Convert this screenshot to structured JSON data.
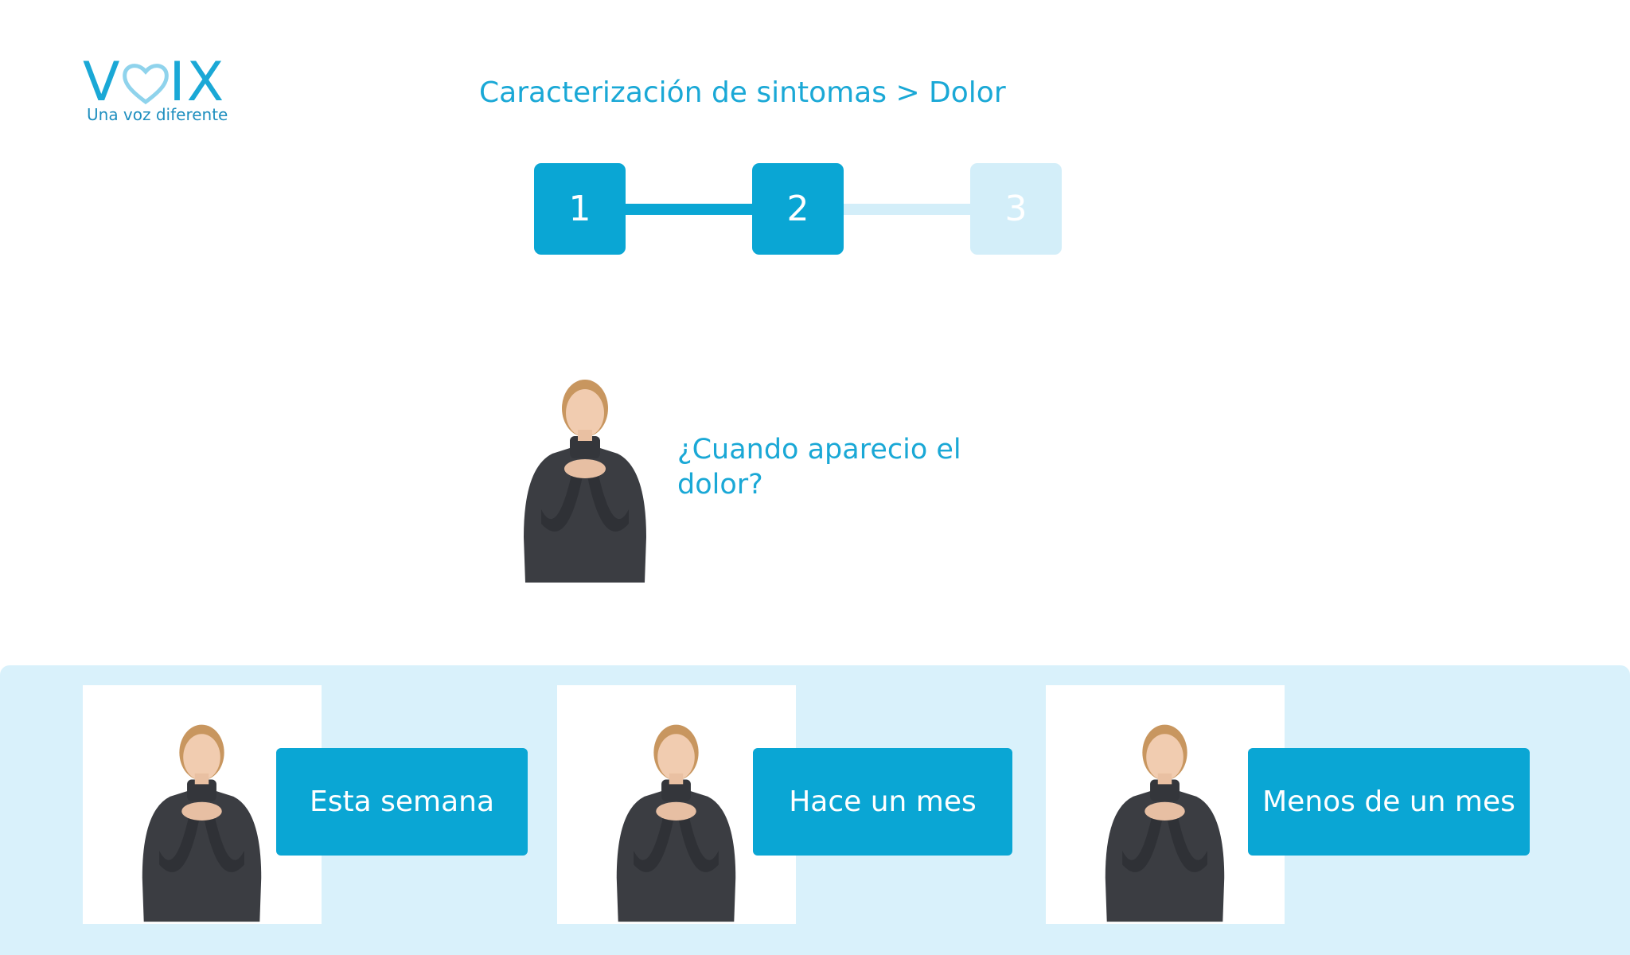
{
  "brand": {
    "name_left": "V",
    "name_right": "IX",
    "tagline": "Una voz diferente",
    "color": "#1aa8d6"
  },
  "breadcrumb": "Caracterización de sintomas > Dolor",
  "stepper": {
    "steps": [
      {
        "label": "1",
        "state": "complete"
      },
      {
        "label": "2",
        "state": "current"
      },
      {
        "label": "3",
        "state": "pending"
      }
    ],
    "active_color": "#0aa6d4",
    "inactive_color": "#d3eef9"
  },
  "question": "¿Cuando aparecio el dolor?",
  "options": [
    {
      "label": "Esta semana"
    },
    {
      "label": "Hace un mes"
    },
    {
      "label": "Menos de un mes"
    }
  ],
  "panel_color": "#d9f1fb"
}
